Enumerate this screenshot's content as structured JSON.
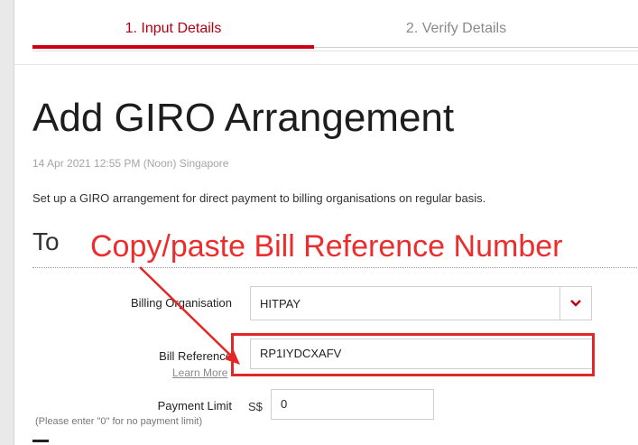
{
  "steps": [
    {
      "label": "1. Input Details",
      "active": true
    },
    {
      "label": "2. Verify Details",
      "active": false
    }
  ],
  "page_title": "Add GIRO Arrangement",
  "timestamp": "14 Apr 2021 12:55 PM (Noon) Singapore",
  "description": "Set up a GIRO arrangement for direct payment to billing organisations on regular basis.",
  "section_heading": "To",
  "form": {
    "billing_org": {
      "label": "Billing Organisation",
      "value": "HITPAY"
    },
    "bill_reference": {
      "label": "Bill Reference",
      "learn_more": "Learn More",
      "value": "RP1IYDCXAFV"
    },
    "payment_limit": {
      "label": "Payment Limit",
      "currency": "S$",
      "value": "0",
      "hint": "(Please enter \"0\" for no payment limit)"
    }
  },
  "annotation": {
    "text": "Copy/paste Bill Reference Number",
    "color": "#e32626"
  },
  "colors": {
    "accent": "#cc0015",
    "annotation": "#e32626"
  },
  "icons": {
    "dropdown": "chevron-down-icon",
    "arrow": "red-arrow-annotation"
  }
}
